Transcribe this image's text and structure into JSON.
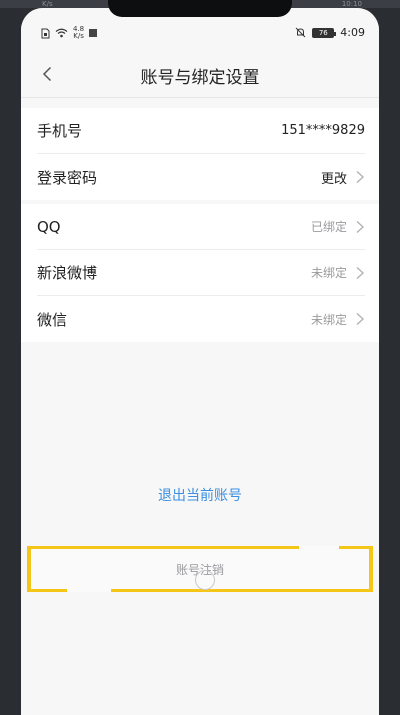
{
  "status_bar": {
    "network_speed_value": "4.8",
    "network_speed_unit": "K/s",
    "battery": "76",
    "time": "4:09"
  },
  "bezel_ghost": {
    "left_text": "K/s",
    "right_text": "10:10"
  },
  "nav": {
    "title": "账号与绑定设置"
  },
  "section1": {
    "phone": {
      "label": "手机号",
      "value": "151****9829"
    },
    "password": {
      "label": "登录密码",
      "value": "更改"
    }
  },
  "section2": {
    "qq": {
      "label": "QQ",
      "value": "已绑定"
    },
    "weibo": {
      "label": "新浪微博",
      "value": "未绑定"
    },
    "wechat": {
      "label": "微信",
      "value": "未绑定"
    }
  },
  "actions": {
    "logout": "退出当前账号",
    "cancel_account": "账号注销"
  },
  "colors": {
    "accent_link": "#3a8fe0",
    "highlight": "#f5c518",
    "muted_text": "#9a9a9e"
  }
}
